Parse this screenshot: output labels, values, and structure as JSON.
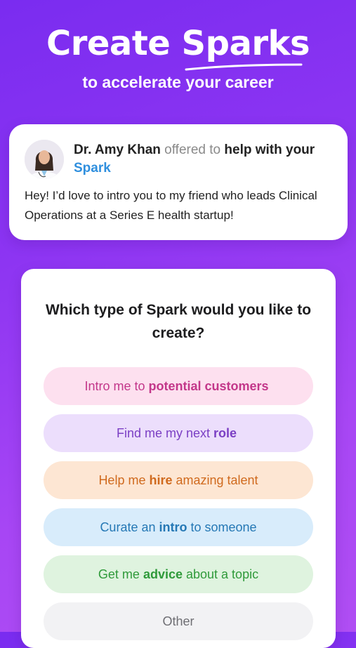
{
  "hero": {
    "title": "Create Sparks",
    "subtitle": "to accelerate your career"
  },
  "offer": {
    "name": "Dr. Amy Khan",
    "verb": "offered to",
    "action": "help with your",
    "target": "Spark",
    "message": "Hey! I’d love to intro you to my friend who leads Clinical Operations at a Series E health startup!"
  },
  "picker": {
    "question": "Which type of Spark would you like to create?",
    "options": [
      {
        "pre": "Intro me to",
        "bold": "potential customers",
        "post": ""
      },
      {
        "pre": "Find me my next",
        "bold": "role",
        "post": ""
      },
      {
        "pre": "Help me",
        "bold": "hire",
        "post": "amazing talent"
      },
      {
        "pre": "Curate an",
        "bold": "intro",
        "post": "to someone"
      },
      {
        "pre": "Get me",
        "bold": "advice",
        "post": "about a topic"
      },
      {
        "pre": "Other",
        "bold": "",
        "post": ""
      }
    ]
  },
  "colors": {
    "bg_start": "#7a2cf0",
    "bg_end": "#b04ef3",
    "spark_link": "#2f8fde"
  }
}
